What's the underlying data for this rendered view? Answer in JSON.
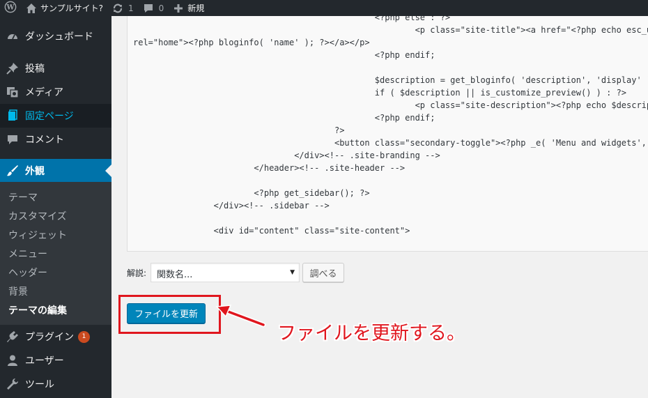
{
  "adminbar": {
    "site_name": "サンプルサイト?",
    "updates_count": "1",
    "comments_count": "0",
    "new_label": "新規"
  },
  "sidebar": {
    "dashboard": "ダッシュボード",
    "posts": "投稿",
    "media": "メディア",
    "pages": "固定ページ",
    "comments": "コメント",
    "appearance": "外観",
    "submenu": [
      "テーマ",
      "カスタマイズ",
      "ウィジェット",
      "メニュー",
      "ヘッダー",
      "背景",
      "テーマの編集"
    ],
    "plugins": "プラグイン",
    "plugins_badge": "1",
    "users": "ユーザー",
    "tools": "ツール"
  },
  "code_lines": [
    "                                                <?php else : ?>",
    "                                                        <p class=\"site-title\"><a href=\"<?php echo esc_url( home_",
    "rel=\"home\"><?php bloginfo( 'name' ); ?></a></p>",
    "                                                <?php endif;",
    "",
    "                                                $description = get_bloginfo( 'description', 'display' );",
    "                                                if ( $description || is_customize_preview() ) : ?>",
    "                                                        <p class=\"site-description\"><?php echo $description; ?></",
    "                                                <?php endif;",
    "                                        ?>",
    "                                        <button class=\"secondary-toggle\"><?php _e( 'Menu and widgets', 'twentyfi",
    "                                </div><!-- .site-branding -->",
    "                        </header><!-- .site-header -->",
    "",
    "                        <?php get_sidebar(); ?>",
    "                </div><!-- .sidebar -->",
    "",
    "                <div id=\"content\" class=\"site-content\">"
  ],
  "doc": {
    "label": "解説:",
    "select_value": "関数名...",
    "lookup_button": "調べる"
  },
  "update_button": "ファイルを更新",
  "annotation": "ファイルを更新する。",
  "colors": {
    "adminbar_bg": "#23282d",
    "active_menu": "#0073aa",
    "current_page_text": "#00b9eb",
    "primary_button": "#0085ba",
    "annotation_red": "#e0161e",
    "badge": "#ca4a1f"
  },
  "icons": {
    "wordpress": "wordpress-logo-icon",
    "home": "home-icon",
    "updates": "refresh-icon",
    "comments": "comment-bubble-icon",
    "new": "plus-icon",
    "dashboard": "dashboard-gauge-icon",
    "posts": "pushpin-icon",
    "media": "media-camera-icon",
    "pages": "page-icon",
    "plugins": "plug-icon",
    "users": "user-icon",
    "tools": "wrench-icon",
    "appearance": "paintbrush-icon"
  }
}
